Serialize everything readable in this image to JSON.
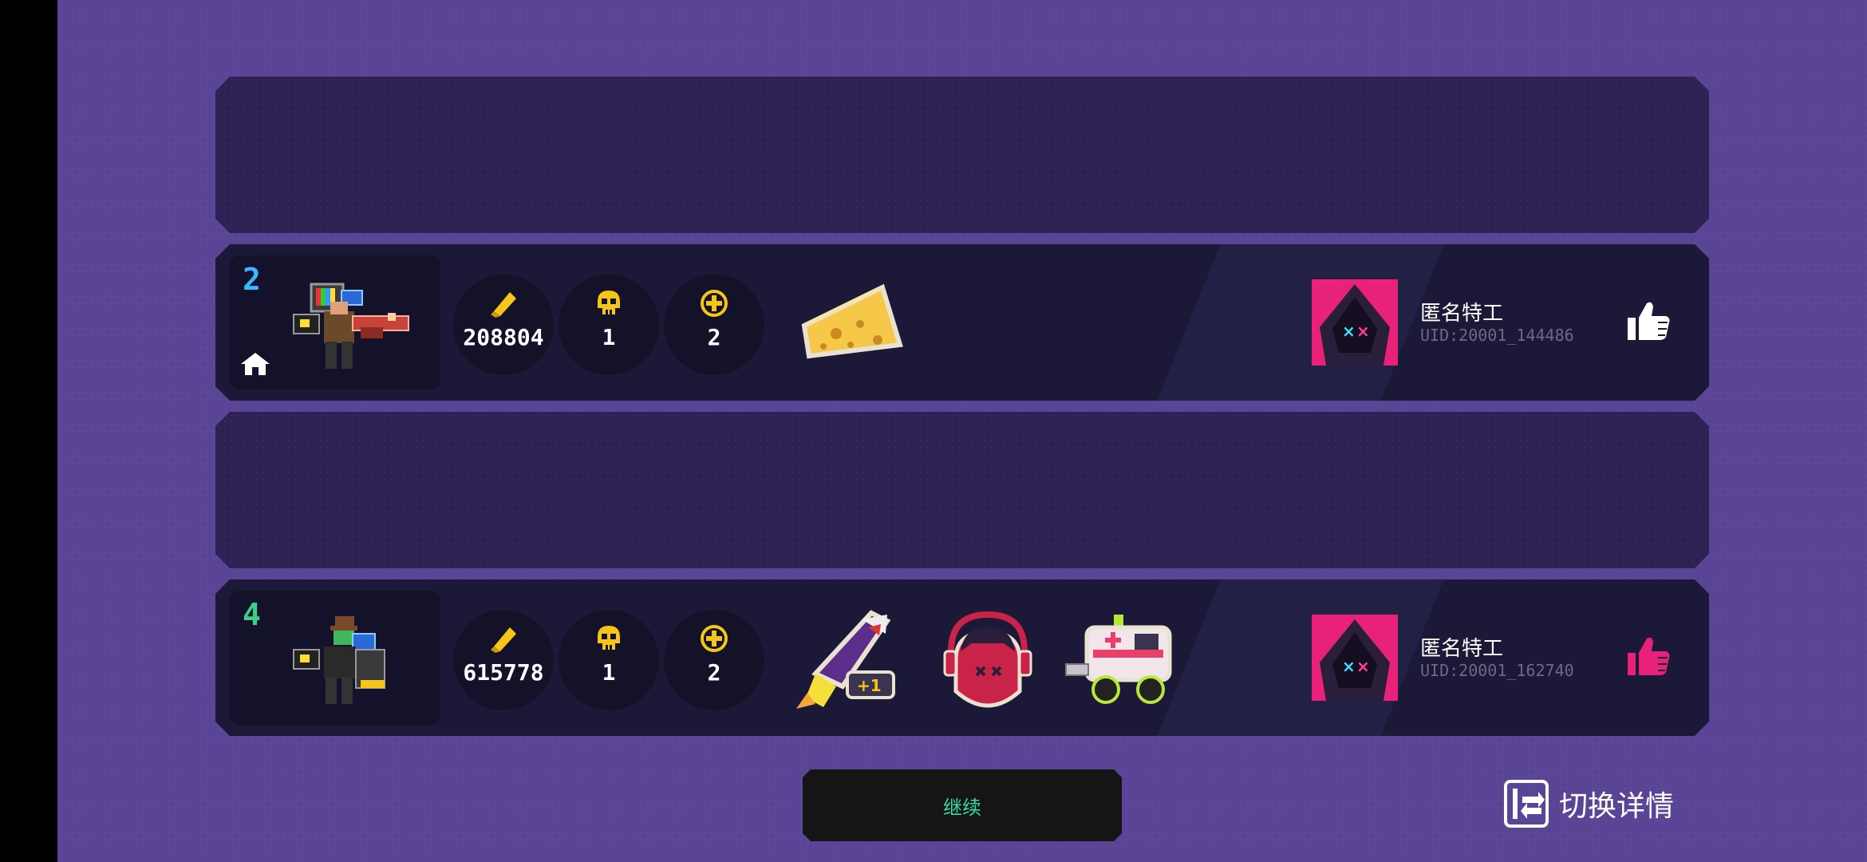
{
  "players": [
    {
      "rank": "2",
      "rank_color": "#3bb6ff",
      "coins": "208804",
      "kills": "1",
      "revives": "2",
      "name": "匿名特工",
      "uid": "UID:20001_144486",
      "liked": false,
      "items": [
        "cheese"
      ],
      "is_host": true
    },
    {
      "rank": "4",
      "rank_color": "#3ccf8a",
      "coins": "615778",
      "kills": "1",
      "revives": "2",
      "name": "匿名特工",
      "uid": "UID:20001_162740",
      "liked": true,
      "items": [
        "shark-rocket",
        "demon-headphones",
        "ambulance"
      ],
      "item_badge": "+1",
      "is_host": false
    }
  ],
  "buttons": {
    "continue": "继续",
    "switch_details": "切换详情"
  },
  "colors": {
    "background": "#5a4496",
    "row_bg": "#1c1838",
    "empty_row_bg": "#2e2254",
    "coin": "#f5c518",
    "like_active": "#e8227a",
    "continue_text": "#36d8a6"
  }
}
